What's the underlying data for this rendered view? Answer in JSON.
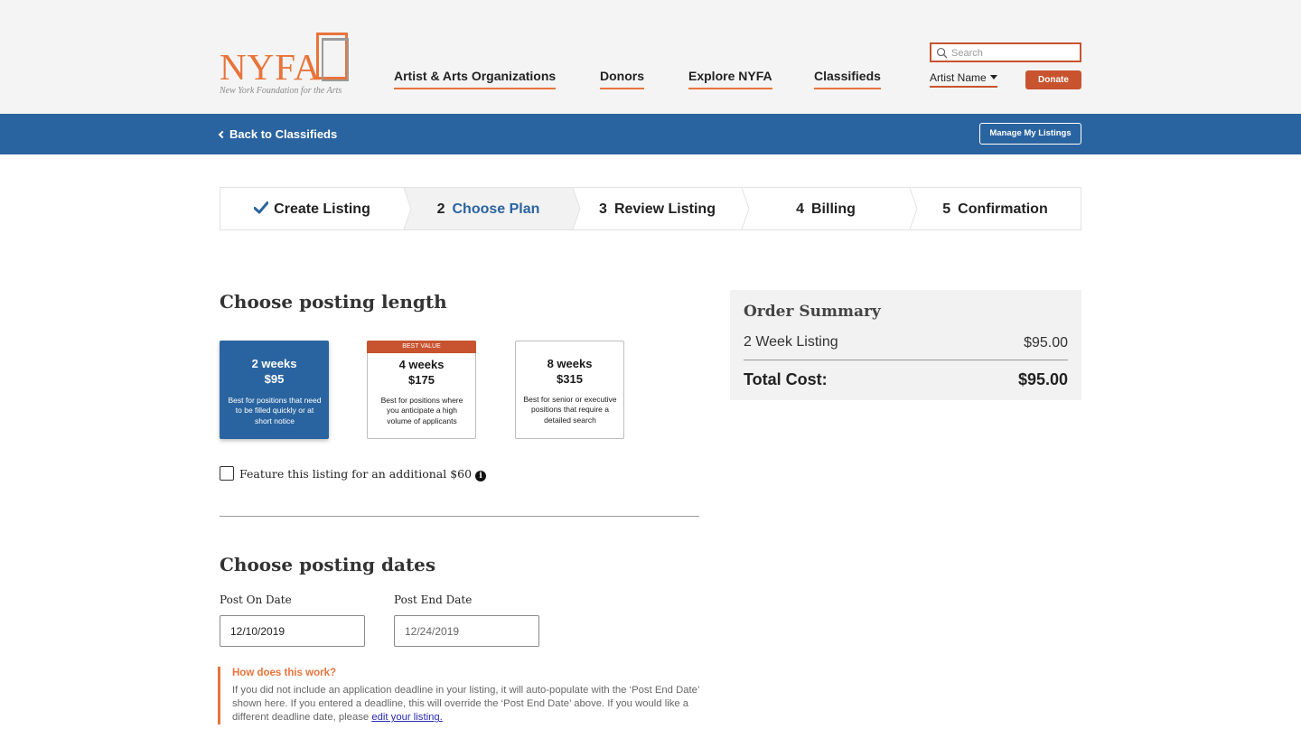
{
  "header": {
    "logo_text": "NYFA",
    "logo_subtitle": "New York Foundation for the Arts",
    "nav": [
      {
        "label": "Artist & Arts Organizations"
      },
      {
        "label": "Donors"
      },
      {
        "label": "Explore NYFA"
      },
      {
        "label": "Classifieds"
      }
    ],
    "search": {
      "placeholder": "Search",
      "value": ""
    },
    "user_menu_label": "Artist Name",
    "donate_label": "Donate",
    "search_icon": "search-icon",
    "caret_icon": "caret-down-icon"
  },
  "subnav": {
    "back_label": "Back to Classifieds",
    "back_icon": "chevron-left-icon",
    "manage_label": "Manage My Listings"
  },
  "steps": [
    {
      "number": "",
      "label": "Create Listing",
      "state": "completed",
      "icon": "check-icon"
    },
    {
      "number": "2",
      "label": "Choose Plan",
      "state": "active"
    },
    {
      "number": "3",
      "label": "Review Listing",
      "state": "upcoming"
    },
    {
      "number": "4",
      "label": "Billing",
      "state": "upcoming"
    },
    {
      "number": "5",
      "label": "Confirmation",
      "state": "upcoming"
    }
  ],
  "posting_length": {
    "heading": "Choose posting length",
    "plans": [
      {
        "weeks": "2 weeks",
        "price": "$95",
        "description": "Best for positions that need to be filled quickly or at short notice",
        "selected": true,
        "badge": ""
      },
      {
        "weeks": "4 weeks",
        "price": "$175",
        "description": "Best for positions where you anticipate a high volume of applicants",
        "selected": false,
        "badge": "BEST VALUE"
      },
      {
        "weeks": "8 weeks",
        "price": "$315",
        "description": "Best for senior or executive positions that require a detailed search",
        "selected": false,
        "badge": ""
      }
    ],
    "feature_label": "Feature this listing for an additional $60",
    "feature_checked": false,
    "info_icon": "info-icon"
  },
  "posting_dates": {
    "heading": "Choose posting dates",
    "post_on_label": "Post On Date",
    "post_on_value": "12/10/2019",
    "post_end_label": "Post End Date",
    "post_end_value": "12/24/2019",
    "help_title": "How does this work?",
    "help_body": "If you did not include an application deadline in your listing, it will auto-populate with the ‘Post End Date’ shown here. If you entered a deadline, this will override the ‘Post End Date’ above. If you would like a different deadline date, please",
    "help_link": "edit your listing."
  },
  "order_summary": {
    "title": "Order Summary",
    "line_item_label": "2 Week Listing",
    "line_item_value": "$95.00",
    "total_label": "Total Cost:",
    "total_value": "$95.00"
  },
  "colors": {
    "brand_orange": "#e8743b",
    "donate_red": "#c8532f",
    "primary_blue": "#2a64a0"
  }
}
